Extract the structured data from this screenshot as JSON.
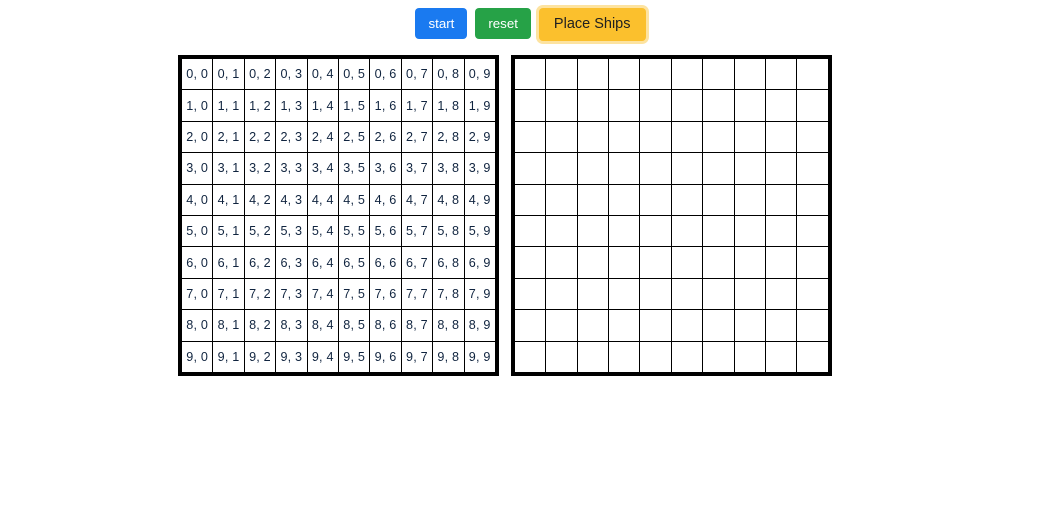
{
  "toolbar": {
    "start_label": "start",
    "reset_label": "reset",
    "place_ships_label": "Place Ships"
  },
  "colors": {
    "start_bg": "#1a7af0",
    "reset_bg": "#26a247",
    "place_ships_bg": "#fbc02d",
    "grid_line": "#000000",
    "cell_text": "#10243f",
    "page_bg": "#ffffff"
  },
  "boards": {
    "player": {
      "rows": 10,
      "cols": 10,
      "cells": [
        [
          "0, 0",
          "0, 1",
          "0, 2",
          "0, 3",
          "0, 4",
          "0, 5",
          "0, 6",
          "0, 7",
          "0, 8",
          "0, 9"
        ],
        [
          "1, 0",
          "1, 1",
          "1, 2",
          "1, 3",
          "1, 4",
          "1, 5",
          "1, 6",
          "1, 7",
          "1, 8",
          "1, 9"
        ],
        [
          "2, 0",
          "2, 1",
          "2, 2",
          "2, 3",
          "2, 4",
          "2, 5",
          "2, 6",
          "2, 7",
          "2, 8",
          "2, 9"
        ],
        [
          "3, 0",
          "3, 1",
          "3, 2",
          "3, 3",
          "3, 4",
          "3, 5",
          "3, 6",
          "3, 7",
          "3, 8",
          "3, 9"
        ],
        [
          "4, 0",
          "4, 1",
          "4, 2",
          "4, 3",
          "4, 4",
          "4, 5",
          "4, 6",
          "4, 7",
          "4, 8",
          "4, 9"
        ],
        [
          "5, 0",
          "5, 1",
          "5, 2",
          "5, 3",
          "5, 4",
          "5, 5",
          "5, 6",
          "5, 7",
          "5, 8",
          "5, 9"
        ],
        [
          "6, 0",
          "6, 1",
          "6, 2",
          "6, 3",
          "6, 4",
          "6, 5",
          "6, 6",
          "6, 7",
          "6, 8",
          "6, 9"
        ],
        [
          "7, 0",
          "7, 1",
          "7, 2",
          "7, 3",
          "7, 4",
          "7, 5",
          "7, 6",
          "7, 7",
          "7, 8",
          "7, 9"
        ],
        [
          "8, 0",
          "8, 1",
          "8, 2",
          "8, 3",
          "8, 4",
          "8, 5",
          "8, 6",
          "8, 7",
          "8, 8",
          "8, 9"
        ],
        [
          "9, 0",
          "9, 1",
          "9, 2",
          "9, 3",
          "9, 4",
          "9, 5",
          "9, 6",
          "9, 7",
          "9, 8",
          "9, 9"
        ]
      ]
    },
    "opponent": {
      "rows": 10,
      "cols": 10,
      "cells": [
        [
          "",
          "",
          "",
          "",
          "",
          "",
          "",
          "",
          "",
          ""
        ],
        [
          "",
          "",
          "",
          "",
          "",
          "",
          "",
          "",
          "",
          ""
        ],
        [
          "",
          "",
          "",
          "",
          "",
          "",
          "",
          "",
          "",
          ""
        ],
        [
          "",
          "",
          "",
          "",
          "",
          "",
          "",
          "",
          "",
          ""
        ],
        [
          "",
          "",
          "",
          "",
          "",
          "",
          "",
          "",
          "",
          ""
        ],
        [
          "",
          "",
          "",
          "",
          "",
          "",
          "",
          "",
          "",
          ""
        ],
        [
          "",
          "",
          "",
          "",
          "",
          "",
          "",
          "",
          "",
          ""
        ],
        [
          "",
          "",
          "",
          "",
          "",
          "",
          "",
          "",
          "",
          ""
        ],
        [
          "",
          "",
          "",
          "",
          "",
          "",
          "",
          "",
          "",
          ""
        ],
        [
          "",
          "",
          "",
          "",
          "",
          "",
          "",
          "",
          "",
          ""
        ]
      ]
    }
  }
}
